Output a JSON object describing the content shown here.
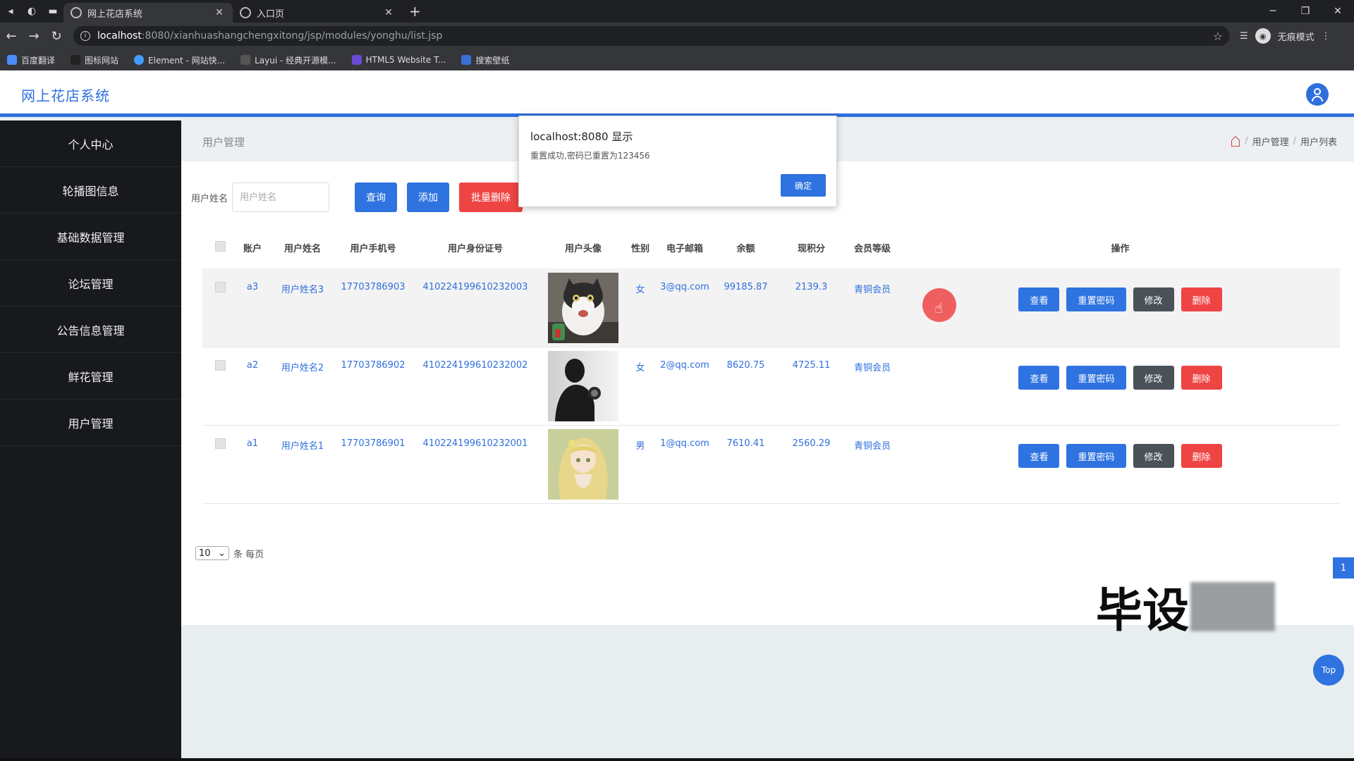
{
  "browser": {
    "tabs": [
      {
        "title": "网上花店系统",
        "active": true
      },
      {
        "title": "入口页",
        "active": false
      }
    ],
    "url_host": "localhost",
    "url_path": ":8080/xianhuashangchengxitong/jsp/modules/yonghu/list.jsp",
    "incognito_label": "无痕模式",
    "bookmarks": [
      "百度翻译",
      "图标网站",
      "Element - 网站快...",
      "Layui - 经典开源模...",
      "HTML5 Website T...",
      "搜索壁纸"
    ]
  },
  "header": {
    "brand": "网上花店系统"
  },
  "sidebar": {
    "items": [
      "个人中心",
      "轮播图信息",
      "基础数据管理",
      "论坛管理",
      "公告信息管理",
      "鲜花管理",
      "用户管理"
    ]
  },
  "breadcrumb": {
    "title": "用户管理",
    "path": [
      "用户管理",
      "用户列表"
    ]
  },
  "search": {
    "label": "用户姓名",
    "placeholder": "用户姓名",
    "query_button": "查询",
    "add_button": "添加",
    "batch_delete_button": "批量删除"
  },
  "table": {
    "columns": [
      "账户",
      "用户姓名",
      "用户手机号",
      "用户身份证号",
      "用户头像",
      "性别",
      "电子邮箱",
      "余额",
      "现积分",
      "会员等级",
      "操作"
    ],
    "rows": [
      {
        "account": "a3",
        "name": "用户姓名3",
        "phone": "17703786903",
        "id_number": "410224199610232003",
        "avatar": "cat-photo",
        "sex": "女",
        "email": "3@qq.com",
        "balance": "99185.87",
        "points": "2139.3",
        "level": "青铜会员"
      },
      {
        "account": "a2",
        "name": "用户姓名2",
        "phone": "17703786902",
        "id_number": "410224199610232002",
        "avatar": "silhouette-photo",
        "sex": "女",
        "email": "2@qq.com",
        "balance": "8620.75",
        "points": "4725.11",
        "level": "青铜会员"
      },
      {
        "account": "a1",
        "name": "用户姓名1",
        "phone": "17703786901",
        "id_number": "410224199610232001",
        "avatar": "anime-girl-photo",
        "sex": "男",
        "email": "1@qq.com",
        "balance": "7610.41",
        "points": "2560.29",
        "level": "青铜会员"
      }
    ],
    "actions": {
      "view": "查看",
      "reset_password": "重置密码",
      "edit": "修改",
      "delete": "删除"
    }
  },
  "pagination": {
    "page_size": "10",
    "per_page_label": "条 每页",
    "current_page": "1"
  },
  "watermark_text": "毕设",
  "top_button": "Top",
  "alert": {
    "title": "localhost:8080 显示",
    "message": "重置成功,密码已重置为123456",
    "ok_button": "确定"
  },
  "colors": {
    "primary": "#2f73e0",
    "danger": "#ef4444",
    "dark_button": "#4b5158",
    "sidebar_bg": "#17191c"
  }
}
